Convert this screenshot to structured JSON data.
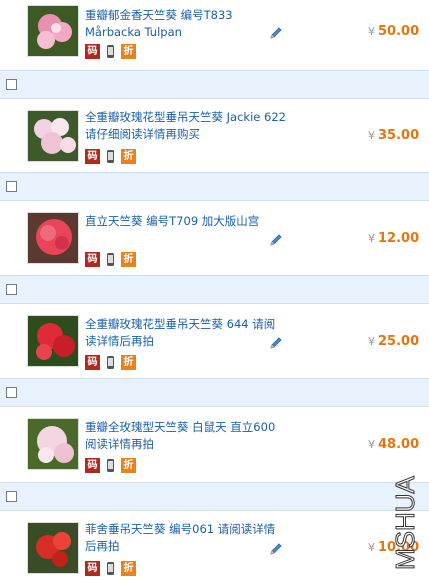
{
  "items": [
    {
      "title": "重瓣郁金香天竺葵 编号T833 Mårbacka Tulpan",
      "price": "50.00",
      "icons": [
        "码",
        "",
        "折"
      ],
      "flower": "#e98fb0",
      "bg": "#3d5a24"
    },
    {
      "title": "全重瓣玫瑰花型垂吊天竺葵 Jackie 622 请仔细阅读详情再购买",
      "price": "35.00",
      "icons": [
        "码",
        "",
        "折"
      ],
      "flower": "#f3d3e3",
      "bg": "#3f5a2a"
    },
    {
      "title": "直立天竺葵 编号T709 加大版山宫",
      "price": "12.00",
      "icons": [
        "码",
        "",
        "折"
      ],
      "flower": "#e9445a",
      "bg": "#5a3a30"
    },
    {
      "title": "全重瓣玫瑰花型垂吊天竺葵 644 请阅读详情后再拍",
      "price": "25.00",
      "icons": [
        "码",
        "",
        "折"
      ],
      "flower": "#e02a36",
      "bg": "#2e4d1e"
    },
    {
      "title": "重瓣全玫瑰型天竺葵 白鼠天 直立600 阅读详情再拍",
      "price": "48.00",
      "icons": [
        "码",
        "",
        "折"
      ],
      "flower": "#f4d6e2",
      "bg": "#4a6a2a"
    },
    {
      "title": "菲舍垂吊天竺葵 编号061 请阅读详情后再拍",
      "price": "10.00",
      "icons": [
        "码",
        "",
        "折"
      ],
      "flower": "#d82d24",
      "bg": "#3a4c25"
    }
  ],
  "currency": "¥",
  "watermark": "MSHUA",
  "colors": {
    "link": "#1a5fa8",
    "price": "#e3760f",
    "separator": "#e8f2fc"
  }
}
